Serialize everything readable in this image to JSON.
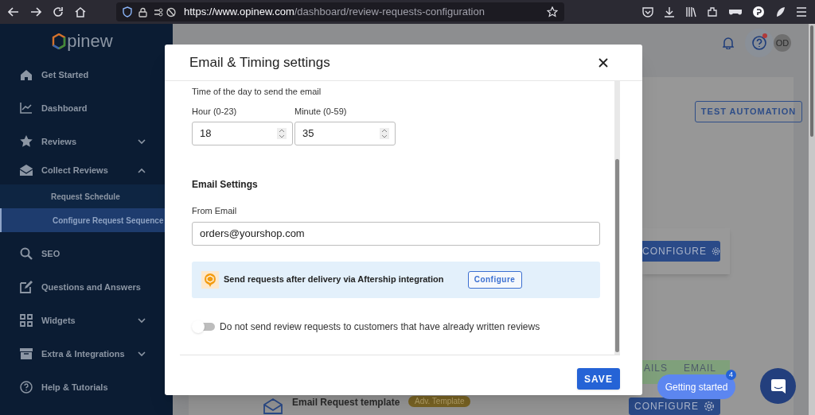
{
  "browser": {
    "url_host": "https://www.opinew.com",
    "url_path": "/dashboard/review-requests-configuration"
  },
  "sidebar": {
    "logo_text": "pinew",
    "items": [
      {
        "label": "Get Started"
      },
      {
        "label": "Dashboard"
      },
      {
        "label": "Reviews",
        "expanded": false
      },
      {
        "label": "Collect Reviews",
        "expanded": true,
        "children": [
          {
            "label": "Request Schedule",
            "selected": false
          },
          {
            "label": "Configure Request Sequence",
            "selected": true
          }
        ]
      },
      {
        "label": "SEO"
      },
      {
        "label": "Questions and Answers"
      },
      {
        "label": "Widgets",
        "expanded": false
      },
      {
        "label": "Extra & Integrations",
        "expanded": false
      },
      {
        "label": "Help & Tutorials"
      }
    ]
  },
  "header": {
    "help_alert": true,
    "avatar": "OD"
  },
  "background": {
    "test_button": "TEST AUTOMATION",
    "configure_buttons": [
      "CONFIGURE",
      "CONFIGURE"
    ],
    "strip_tabs": [
      "AILS",
      "EMAIL"
    ],
    "template": {
      "title": "Email Request template",
      "badge": "Adv. Template"
    }
  },
  "modal": {
    "title": "Email & Timing settings",
    "time_label": "Time of the day to send the email",
    "hour": {
      "label": "Hour (0-23)",
      "value": "18"
    },
    "minute": {
      "label": "Minute (0-59)",
      "value": "35"
    },
    "email_section": "Email Settings",
    "from_email": {
      "label": "From Email",
      "value": "orders@yourshop.com"
    },
    "aftership": {
      "text": "Send requests after delivery via Aftership integration",
      "button": "Configure"
    },
    "toggle": {
      "label": "Do not send review requests to customers that have already written reviews",
      "on": false
    },
    "save": "SAVE"
  },
  "getting_started": {
    "label": "Getting started",
    "count": "4"
  }
}
